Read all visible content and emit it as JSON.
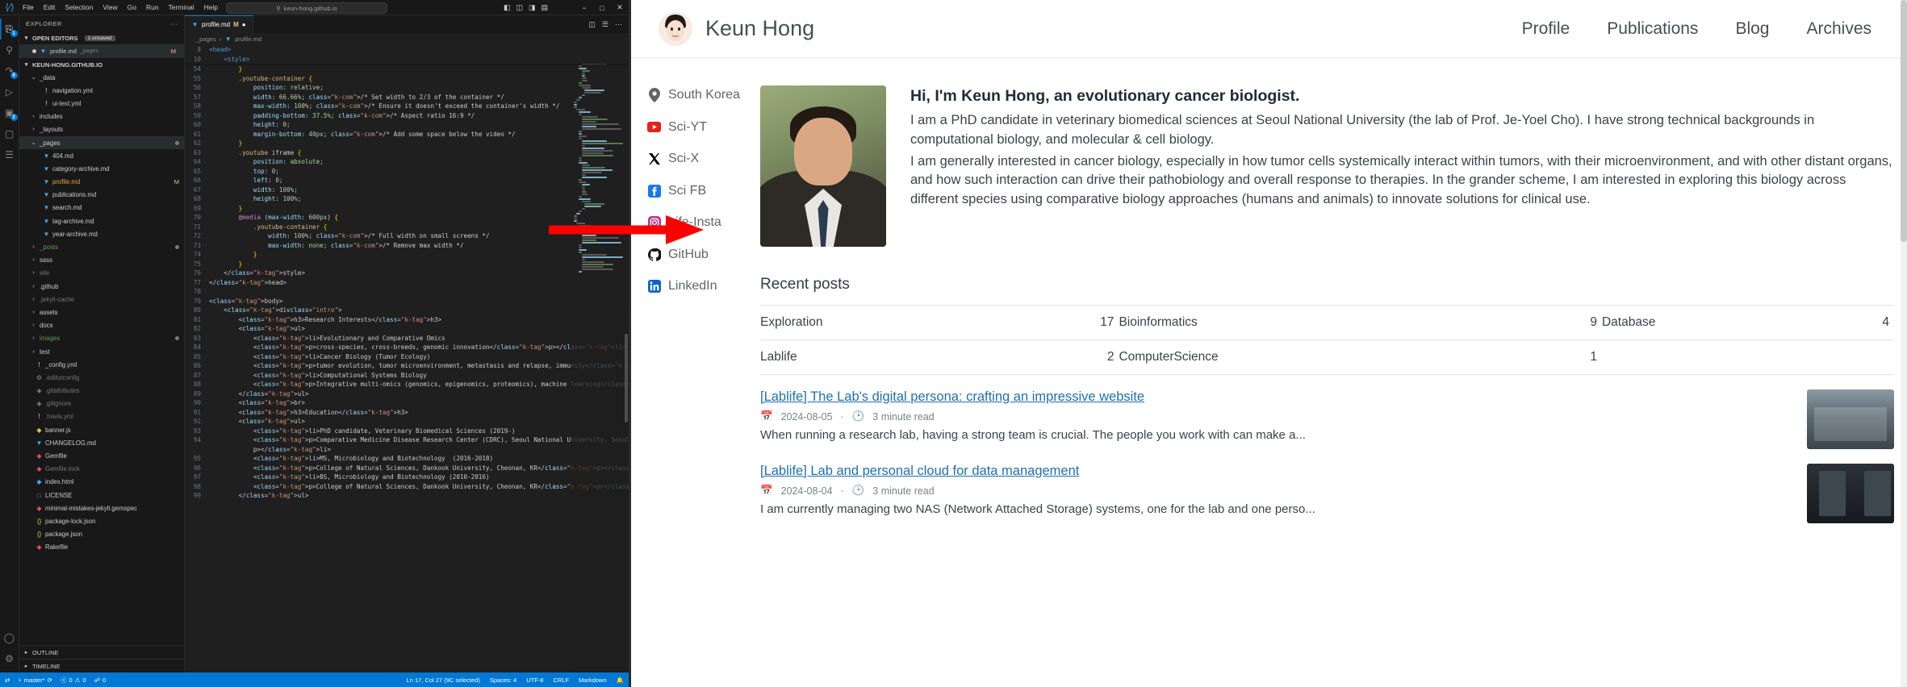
{
  "vscode": {
    "menus": [
      "File",
      "Edit",
      "Selection",
      "View",
      "Go",
      "Run",
      "Terminal",
      "Help"
    ],
    "search_placeholder": "keun-hong.github.io",
    "search_icon": "search-icon",
    "nav_back": "‹",
    "nav_fwd": "›",
    "window_controls": {
      "minimize": "−",
      "maximize": "❐",
      "close": "✕"
    },
    "layout_icons": [
      "panel-left-icon",
      "panel-bottom-icon",
      "panel-right-icon",
      "layout-grid-icon"
    ],
    "activity_bar": [
      {
        "name": "explorer",
        "glyph": "⧉",
        "badge": "1",
        "active": true
      },
      {
        "name": "search",
        "glyph": "⌕",
        "badge": ""
      },
      {
        "name": "source-control",
        "glyph": "⎇",
        "badge": "9"
      },
      {
        "name": "run-debug",
        "glyph": "▷",
        "badge": ""
      },
      {
        "name": "extensions",
        "glyph": "⌸",
        "badge": "2"
      },
      {
        "name": "testing",
        "glyph": "⚗",
        "badge": ""
      },
      {
        "name": "outline-view",
        "glyph": "☰",
        "badge": ""
      }
    ],
    "activity_bottom": [
      {
        "name": "accounts",
        "glyph": "○"
      },
      {
        "name": "settings-gear",
        "glyph": "⚙"
      }
    ],
    "sidebar": {
      "title": "EXPLORER",
      "more_actions": "···",
      "open_editors": {
        "label": "OPEN EDITORS",
        "badge": "1 unsaved",
        "rows": [
          {
            "name": "profile.md",
            "sub": "_pages",
            "flag": "M",
            "dirty": true
          }
        ]
      },
      "project": {
        "label": "KEUN-HONG.GITHUB.IO",
        "items": [
          {
            "label": "_data",
            "indent": 1,
            "type": "folder-open",
            "style": ""
          },
          {
            "label": "navigation.yml",
            "indent": 2,
            "type": "yml",
            "style": ""
          },
          {
            "label": "ui-text.yml",
            "indent": 2,
            "type": "yml",
            "style": ""
          },
          {
            "label": "includes",
            "indent": 1,
            "type": "folder",
            "style": ""
          },
          {
            "label": "_layouts",
            "indent": 1,
            "type": "folder",
            "style": ""
          },
          {
            "label": "_pages",
            "indent": 1,
            "type": "folder-open",
            "style": "",
            "selected": true,
            "dot": true
          },
          {
            "label": "404.md",
            "indent": 2,
            "type": "md",
            "style": ""
          },
          {
            "label": "category-archive.md",
            "indent": 2,
            "type": "md",
            "style": ""
          },
          {
            "label": "profile.md",
            "indent": 2,
            "type": "md",
            "style": "orange",
            "flag": "M"
          },
          {
            "label": "publications.md",
            "indent": 2,
            "type": "md",
            "style": ""
          },
          {
            "label": "search.md",
            "indent": 2,
            "type": "md",
            "style": ""
          },
          {
            "label": "tag-archive.md",
            "indent": 2,
            "type": "md",
            "style": ""
          },
          {
            "label": "year-archive.md",
            "indent": 2,
            "type": "md",
            "style": ""
          },
          {
            "label": "_posts",
            "indent": 1,
            "type": "folder",
            "style": "green",
            "dot": true
          },
          {
            "label": "sass",
            "indent": 1,
            "type": "folder",
            "style": ""
          },
          {
            "label": "site",
            "indent": 1,
            "type": "folder",
            "style": "dimmed"
          },
          {
            "label": ".github",
            "indent": 1,
            "type": "folder",
            "style": ""
          },
          {
            "label": ".jekyll-cache",
            "indent": 1,
            "type": "folder",
            "style": "dimmed"
          },
          {
            "label": "assets",
            "indent": 1,
            "type": "folder",
            "style": ""
          },
          {
            "label": "docs",
            "indent": 1,
            "type": "folder",
            "style": ""
          },
          {
            "label": "images",
            "indent": 1,
            "type": "folder",
            "style": "green",
            "dot": true
          },
          {
            "label": "test",
            "indent": 1,
            "type": "folder",
            "style": ""
          },
          {
            "label": "_config.yml",
            "indent": 1,
            "type": "yml",
            "style": ""
          },
          {
            "label": ".editorconfig",
            "indent": 1,
            "type": "gear",
            "style": "dimmed"
          },
          {
            "label": ".gitattributes",
            "indent": 1,
            "type": "git",
            "style": "dimmed"
          },
          {
            "label": ".gitignore",
            "indent": 1,
            "type": "git",
            "style": "dimmed"
          },
          {
            "label": ".travis.yml",
            "indent": 1,
            "type": "yml",
            "style": "dimmed"
          },
          {
            "label": "banner.js",
            "indent": 1,
            "type": "js",
            "style": ""
          },
          {
            "label": "CHANGELOG.md",
            "indent": 1,
            "type": "md",
            "style": ""
          },
          {
            "label": "Gemfile",
            "indent": 1,
            "type": "ruby",
            "style": ""
          },
          {
            "label": "Gemfile.lock",
            "indent": 1,
            "type": "ruby",
            "style": "dimmed"
          },
          {
            "label": "index.html",
            "indent": 1,
            "type": "html",
            "style": ""
          },
          {
            "label": "LICENSE",
            "indent": 1,
            "type": "file",
            "style": ""
          },
          {
            "label": "minimal-mistakes-jekyll.gemspec",
            "indent": 1,
            "type": "ruby",
            "style": ""
          },
          {
            "label": "package-lock.json",
            "indent": 1,
            "type": "json",
            "style": ""
          },
          {
            "label": "package.json",
            "indent": 1,
            "type": "json",
            "style": ""
          },
          {
            "label": "Rakefile",
            "indent": 1,
            "type": "ruby",
            "style": ""
          }
        ]
      },
      "footer": [
        {
          "label": "OUTLINE"
        },
        {
          "label": "TIMELINE"
        }
      ]
    },
    "editor": {
      "tab": {
        "filename": "profile.md",
        "modified_flag": "M",
        "dirty_dot": "●"
      },
      "tab_actions": [
        "split-editor-icon",
        "run-markdown-preview-icon",
        "more-actions-icon"
      ],
      "breadcrumb": [
        "_pages",
        "profile.md"
      ],
      "sticky_lines": [
        {
          "num": "8",
          "text": "<head>"
        },
        {
          "num": "10",
          "text": "    <style>"
        }
      ],
      "lines": [
        {
          "num": "54",
          "text": "        }"
        },
        {
          "num": "55",
          "text": "        .youtube-container {"
        },
        {
          "num": "56",
          "text": "            position: relative;"
        },
        {
          "num": "57",
          "text": "            width: 66.66%; /* Set width to 2/3 of the container */"
        },
        {
          "num": "58",
          "text": "            max-width: 100%; /* Ensure it doesn't exceed the container's width */"
        },
        {
          "num": "59",
          "text": "            padding-bottom: 37.5%; /* Aspect ratio 16:9 */"
        },
        {
          "num": "60",
          "text": "            height: 0;"
        },
        {
          "num": "61",
          "text": "            margin-bottom: 40px; /* Add some space below the video */"
        },
        {
          "num": "62",
          "text": "        }"
        },
        {
          "num": "63",
          "text": "        .youtube iframe {"
        },
        {
          "num": "64",
          "text": "            position: absolute;"
        },
        {
          "num": "65",
          "text": "            top: 0;"
        },
        {
          "num": "66",
          "text": "            left: 0;"
        },
        {
          "num": "67",
          "text": "            width: 100%;"
        },
        {
          "num": "68",
          "text": "            height: 100%;"
        },
        {
          "num": "69",
          "text": "        }"
        },
        {
          "num": "70",
          "text": "        @media (max-width: 600px) {"
        },
        {
          "num": "71",
          "text": "            .youtube-container {"
        },
        {
          "num": "72",
          "text": "                width: 100%; /* Full width on small screens */"
        },
        {
          "num": "73",
          "text": "                max-width: none; /* Remove max width */"
        },
        {
          "num": "74",
          "text": "            }"
        },
        {
          "num": "75",
          "text": "        }"
        },
        {
          "num": "76",
          "text": "    </style>"
        },
        {
          "num": "77",
          "text": "</head>"
        },
        {
          "num": "78",
          "text": ""
        },
        {
          "num": "79",
          "text": "<body>"
        },
        {
          "num": "80",
          "text": "    <div class=\"intro\">"
        },
        {
          "num": "81",
          "text": "        <h3>Research Interests</h3>"
        },
        {
          "num": "82",
          "text": "        <ul>"
        },
        {
          "num": "83",
          "text": "            <li>Evolutionary and Comparative Omics"
        },
        {
          "num": "84",
          "text": "            <p>cross-species, cross-breeds, genomic innovation</p></li>"
        },
        {
          "num": "85",
          "text": "            <li>Cancer Biology (Tumor Ecology)"
        },
        {
          "num": "86",
          "text": "            <p>tumor evolution, tumor microenvironment, metastasis and relapse, immunity</p></li>"
        },
        {
          "num": "87",
          "text": "            <li>Computational Systems Biology"
        },
        {
          "num": "88",
          "text": "            <p>Integrative multi-omics (genomics, epigenomics, proteomics), machine learning</p></li>"
        },
        {
          "num": "89",
          "text": "        </ul>"
        },
        {
          "num": "90",
          "text": "        <br>"
        },
        {
          "num": "91",
          "text": "        <h3>Education</h3>"
        },
        {
          "num": "92",
          "text": "        <ul>"
        },
        {
          "num": "93",
          "text": "            <li>PhD candidate, Veterinary Biomedical Sciences (2019-)"
        },
        {
          "num": "94",
          "text": "            <p>Comparative Medicine Disease Research Center (CDRC), Seoul National University, Seoul, KR</"
        },
        {
          "num": "",
          "text": "            p></li>"
        },
        {
          "num": "95",
          "text": "            <li>MS, Microbiology and Biotechnology  (2016-2018)"
        },
        {
          "num": "96",
          "text": "            <p>College of Natural Sciences, Dankook University, Cheonan, KR</p></li>"
        },
        {
          "num": "97",
          "text": "            <li>BS, Microbiology and Biotechnology (2010-2016)"
        },
        {
          "num": "98",
          "text": "            <p>College of Natural Sciences, Dankook University, Cheonan, KR</p></li>"
        },
        {
          "num": "99",
          "text": "        </ul>"
        }
      ]
    },
    "statusbar": {
      "remote_icon": "remote-window-icon",
      "branch_icon": "source-control-branch-icon",
      "branch": "master*",
      "sync_icon": "⟳",
      "errors_icon": "ⓧ",
      "errors": "0",
      "warnings_icon": "⚠",
      "warnings": "0",
      "ports_icon": "⎇",
      "ports": "0",
      "bell_icon": "ὑ4",
      "right": {
        "cursor": "Ln 17, Col 27 (9C selected)",
        "spaces": "Spaces: 4",
        "encoding": "UTF-8",
        "eol": "CRLF",
        "language": "Markdown"
      }
    }
  },
  "annotation": {
    "arrow_color": "#ff0000",
    "arrow_name": "red-pointer-arrow"
  },
  "site": {
    "header": {
      "avatar_name": "profile-avatar",
      "brand": "Keun Hong",
      "nav": [
        {
          "label": "Profile"
        },
        {
          "label": "Publications"
        },
        {
          "label": "Blog"
        },
        {
          "label": "Archives"
        }
      ]
    },
    "sidebar_meta": [
      {
        "icon": "location-pin-icon",
        "label": "South Korea",
        "color": "#5f6569"
      },
      {
        "icon": "youtube-icon",
        "label": "Sci-YT",
        "color": "#e62117"
      },
      {
        "icon": "x-twitter-icon",
        "label": "Sci-X",
        "color": "#000000"
      },
      {
        "icon": "facebook-icon",
        "label": "Sci FB",
        "color": "#1877f2"
      },
      {
        "icon": "instagram-icon",
        "label": "Life-Insta",
        "color": "#c13584"
      },
      {
        "icon": "github-icon",
        "label": "GitHub",
        "color": "#171515"
      },
      {
        "icon": "linkedin-icon",
        "label": "LinkedIn",
        "color": "#0a66c2"
      }
    ],
    "intro": {
      "photo_name": "profile-photo",
      "heading": "Hi, I'm Keun Hong, an evolutionary cancer biologist.",
      "paragraphs": [
        "I am a PhD candidate in veterinary biomedical sciences at Seoul National University (the lab of Prof. Je-Yoel Cho). I have strong technical backgrounds in computational biology, and molecular & cell biology.",
        "I am generally interested in cancer biology, especially in how tumor cells systemically interact within tumors, with their microenvironment, and with other distant organs, and how such interaction can drive their pathobiology and overall response to therapies. In the grander scheme, I am interested in exploring this biology across different species using comparative biology approaches (humans and animals) to innovate solutions for clinical use."
      ]
    },
    "recent": {
      "title": "Recent posts",
      "categories": [
        [
          {
            "name": "Exploration",
            "count": "17"
          },
          {
            "name": "Bioinformatics",
            "count": "9"
          },
          {
            "name": "Database",
            "count": "4"
          }
        ],
        [
          {
            "name": "Lablife",
            "count": "2"
          },
          {
            "name": "ComputerScience",
            "count": "1"
          },
          {
            "name": "",
            "count": ""
          }
        ]
      ],
      "posts": [
        {
          "title": "[Lablife] The Lab's digital persona: crafting an impressive website",
          "date_icon": "calendar-icon",
          "date": "2024-08-05",
          "read_icon": "clock-icon",
          "read_time": "3 minute read",
          "excerpt": "When running a research lab, having a strong team is crucial. The people you work with can make a...",
          "thumb_name": "post-thumbnail-lab-website"
        },
        {
          "title": "[Lablife] Lab and personal cloud for data management",
          "date_icon": "calendar-icon",
          "date": "2024-08-04",
          "read_icon": "clock-icon",
          "read_time": "3 minute read",
          "excerpt": "I am currently managing two NAS (Network Attached Storage) systems, one for the lab and one perso...",
          "thumb_name": "post-thumbnail-nas"
        }
      ]
    }
  }
}
